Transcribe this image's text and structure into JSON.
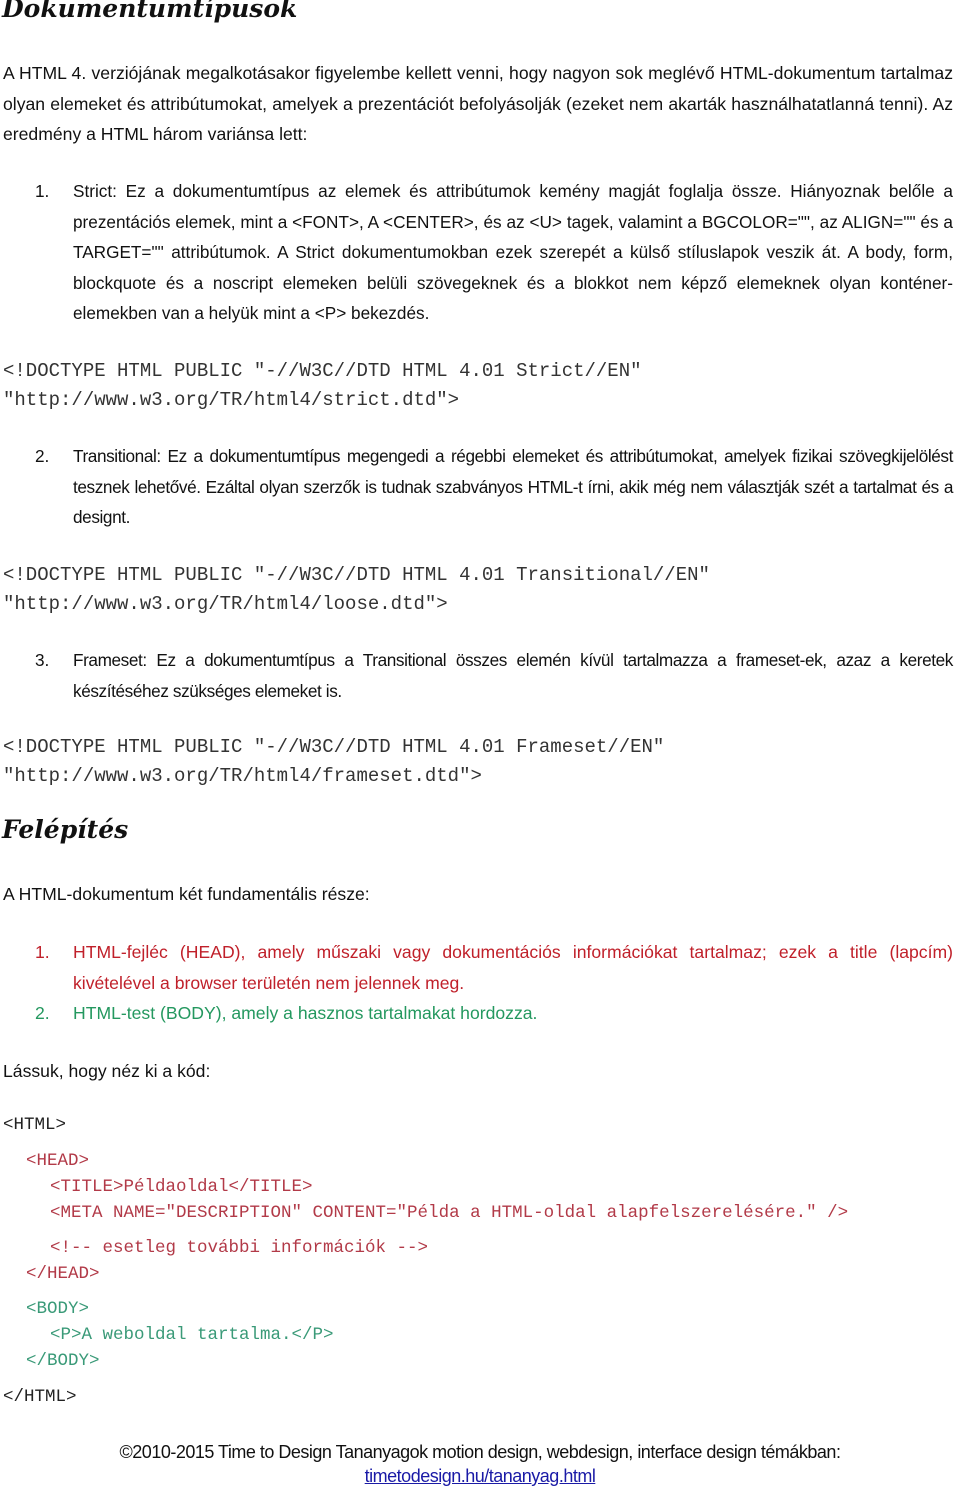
{
  "section1": {
    "title": "Dokumentumtípusok",
    "intro": "A HTML 4. verziójának megalkotásakor figyelembe kellett venni, hogy nagyon sok meglévő HTML-dokumentum tartalmaz olyan elemeket és attribútumokat, amelyek a prezentációt befolyásolják (ezeket nem akarták használhatatlanná tenni). Az eredmény a HTML három variánsa lett:",
    "doctypes": [
      {
        "number": "1.",
        "text": "Strict: Ez a dokumentumtípus az elemek és attribútumok kemény magját foglalja össze. Hiányoznak belőle a prezentációs elemek, mint a <FONT>, A <CENTER>, és az <U> tagek, valamint a BGCOLOR=\"\", az ALIGN=\"\" és a TARGET=\"\" attribútumok. A Strict dokumentumokban ezek szerepét a külső stíluslapok veszik át. A body, form, blockquote és a noscript elemeken belüli szövegeknek és a blokkot nem képző elemeknek olyan konténer-elemekben van a helyük mint a <P> bekezdés.",
        "code_line1": "<!DOCTYPE HTML PUBLIC \"-//W3C//DTD HTML 4.01 Strict//EN\"",
        "code_line2": "\"http://www.w3.org/TR/html4/strict.dtd\">"
      },
      {
        "number": "2.",
        "text": "Transitional: Ez a dokumentumtípus megengedi a régebbi elemeket és attribútumokat, amelyek fizikai szövegkijelölést tesznek lehetővé. Ezáltal olyan szerzők is tudnak szabványos HTML-t írni, akik még nem választják szét a tartalmat és a designt.",
        "code_line1": "<!DOCTYPE HTML PUBLIC \"-//W3C//DTD HTML 4.01 Transitional//EN\"",
        "code_line2": "\"http://www.w3.org/TR/html4/loose.dtd\">"
      },
      {
        "number": "3.",
        "text": "Frameset: Ez a dokumentumtípus a Transitional összes elemén kívül tartalmazza a frameset-ek, azaz a keretek készítéséhez szükséges elemeket is.",
        "code_line1": "<!DOCTYPE HTML PUBLIC \"-//W3C//DTD HTML 4.01 Frameset//EN\"",
        "code_line2": "\"http://www.w3.org/TR/html4/frameset.dtd\">"
      }
    ]
  },
  "section2": {
    "title": "Felépítés",
    "intro": "A HTML-dokumentum két fundamentális része:",
    "parts": [
      {
        "number": "1.",
        "text": "HTML-fejléc (HEAD), amely műszaki vagy dokumentációs információkat tartalmaz; ezek a title (lapcím) kivételével a browser területén nem jelennek meg.",
        "color": "#C0202A"
      },
      {
        "number": "2.",
        "text": "HTML-test (BODY), amely a hasznos tartalmakat hordozza.",
        "color": "#24985F"
      }
    ],
    "code_intro": "Lássuk, hogy néz ki a kód:",
    "code": {
      "html_open": "<HTML>",
      "head_open": "<HEAD>",
      "title_line": "<TITLE>Példaoldal</TITLE>",
      "meta_line": "<META NAME=\"DESCRIPTION\" CONTENT=\"Példa a HTML-oldal alapfelszerelésére.\" />",
      "comment_line": "<!-- esetleg további információk -->",
      "head_close": "</HEAD>",
      "body_open": "<BODY>",
      "p_line": "<P>A weboldal tartalma.</P>",
      "body_close": "</BODY>",
      "html_close": "</HTML>"
    }
  },
  "footer": {
    "text": "©2010-2015 Time to Design Tananyagok motion design, webdesign, interface design témákban:",
    "link": "timetodesign.hu/tananyag.html"
  },
  "colors": {
    "head_red": "#C0202A",
    "body_green": "#24985F",
    "code_red": "#B23A48",
    "code_green": "#3A9A78",
    "link_blue": "#1a1aa6"
  }
}
